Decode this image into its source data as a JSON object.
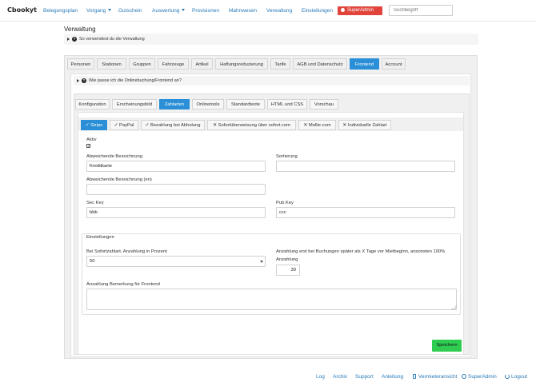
{
  "app": {
    "logo": "Cbookyt"
  },
  "topnav": {
    "items": [
      "Belegungsplan",
      "Vorgang",
      "Gutschein",
      "Auswertung",
      "Provisionen",
      "Mahnwesen",
      "Verwaltung",
      "Einstellungen"
    ],
    "superadmin_label": "SuperAdmin",
    "search_placeholder": "Suchbegriff"
  },
  "page": {
    "title": "Verwaltung",
    "info_toggle": "So verwendest du die Verwaltung"
  },
  "main_tabs": [
    "Personen",
    "Stationen",
    "Gruppen",
    "Fahrzeuge",
    "Artikel",
    "Haftungsreduzierung",
    "Tarife",
    "AGB und Datenschutz",
    "Frontend",
    "Account"
  ],
  "main_tab_active": "Frontend",
  "frontend_info": "Wie passe ich die Onlinebuchung/Frontend an?",
  "sub_tabs": [
    "Konfiguration",
    "Erscheinungsbild",
    "Zahlarten",
    "Onlinetools",
    "Standardtexte",
    "HTML und CSS",
    "Vorschau"
  ],
  "sub_tab_active": "Zahlarten",
  "payment_tabs": [
    {
      "mark": "✓",
      "label": "Stripe",
      "enabled": true
    },
    {
      "mark": "✓",
      "label": "PayPal",
      "enabled": true
    },
    {
      "mark": "✓",
      "label": "Bezahlung bei Abholung",
      "enabled": true
    },
    {
      "mark": "✕",
      "label": "Sofortüberweisung über sofort.com",
      "enabled": false
    },
    {
      "mark": "✕",
      "label": "Mollie.com",
      "enabled": false
    },
    {
      "mark": "✕",
      "label": "Individuelle Zahlart",
      "enabled": false
    }
  ],
  "payment_tab_active": "Stripe",
  "form": {
    "aktiv_label": "Aktiv",
    "aktiv_checked": true,
    "abw_bezeichnung_label": "Abweichende Bezeichnung",
    "abw_bezeichnung_value": "Kreditkarte",
    "sortierung_label": "Sortierung",
    "sortierung_value": "",
    "abw_bezeichnung_en_label": "Abweichende Bezeichnung (en)",
    "abw_bezeichnung_en_value": "",
    "sec_key_label": "Sec Key",
    "sec_key_value": "bbb",
    "pub_key_label": "Pub Key",
    "pub_key_value": "ccc"
  },
  "settings": {
    "legend": "Einstellungen",
    "anzahlung_prozent_label": "Bei Sofortzahlart, Anzahlung in Prozent",
    "anzahlung_prozent_value": "50",
    "anzahlung_tage_label": "Anzahlung erst bei Buchungen später als X Tage vor Mietbeginn, ansonsten 100%",
    "anzahlung_label": "Anzahlung",
    "anzahlung_tage_value": "30",
    "bemerkung_label": "Anzahlung Bemerkung für Frontend"
  },
  "save_label": "Speichern",
  "footer": {
    "links": [
      "Log",
      "Archiv",
      "Support",
      "Anleitung"
    ],
    "vermieter_label": "Vermieteransicht",
    "superadmin_label": "SuperAdmin",
    "logout_label": "Logout"
  },
  "colors": {
    "accent": "#2a8fd6",
    "danger": "#e0443b",
    "save": "#2ecc50",
    "link": "#2a7ab8"
  }
}
